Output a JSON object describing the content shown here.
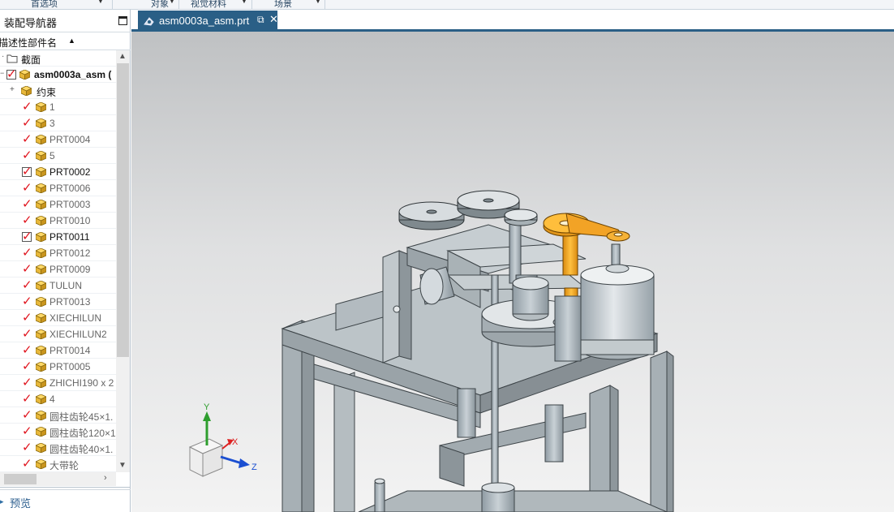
{
  "ribbon": {
    "groups": [
      "首选项",
      "对象",
      "视觉材料",
      "场景"
    ]
  },
  "navigator": {
    "title": "装配导航器",
    "column_header": "描述性部件名",
    "rows": [
      {
        "label": "截面",
        "type": "folder"
      },
      {
        "label": "asm0003a_asm  (",
        "type": "assembly"
      },
      {
        "label": "约束",
        "type": "constraints"
      },
      {
        "label": "1",
        "type": "part"
      },
      {
        "label": "3",
        "type": "part"
      },
      {
        "label": "PRT0004",
        "type": "part"
      },
      {
        "label": "5",
        "type": "part"
      },
      {
        "label": "PRT0002",
        "type": "part-checked"
      },
      {
        "label": "PRT0006",
        "type": "part"
      },
      {
        "label": "PRT0003",
        "type": "part"
      },
      {
        "label": "PRT0010",
        "type": "part"
      },
      {
        "label": "PRT0011",
        "type": "part-checked"
      },
      {
        "label": "PRT0012",
        "type": "part"
      },
      {
        "label": "PRT0009",
        "type": "part"
      },
      {
        "label": "TULUN",
        "type": "part"
      },
      {
        "label": "PRT0013",
        "type": "part"
      },
      {
        "label": "XIECHILUN",
        "type": "part"
      },
      {
        "label": "XIECHILUN2",
        "type": "part"
      },
      {
        "label": "PRT0014",
        "type": "part"
      },
      {
        "label": "PRT0005",
        "type": "part"
      },
      {
        "label": "ZHICHI190 x 2",
        "type": "part"
      },
      {
        "label": "4",
        "type": "part"
      },
      {
        "label": "圆柱齿轮45×1.",
        "type": "part"
      },
      {
        "label": "圆柱齿轮120×1",
        "type": "part"
      },
      {
        "label": "圆柱齿轮40×1.",
        "type": "part"
      },
      {
        "label": "大带轮",
        "type": "part"
      }
    ],
    "preview_label": "预览"
  },
  "tab": {
    "name": "asm0003a_asm.prt"
  },
  "triad": {
    "x_label": "X",
    "y_label": "Y",
    "z_label": "Z"
  },
  "colors": {
    "tab_active": "#2a5f86",
    "check_red": "#e0141e",
    "part_yellow": "#e8b83a",
    "belt_orange": "#f0a020"
  }
}
